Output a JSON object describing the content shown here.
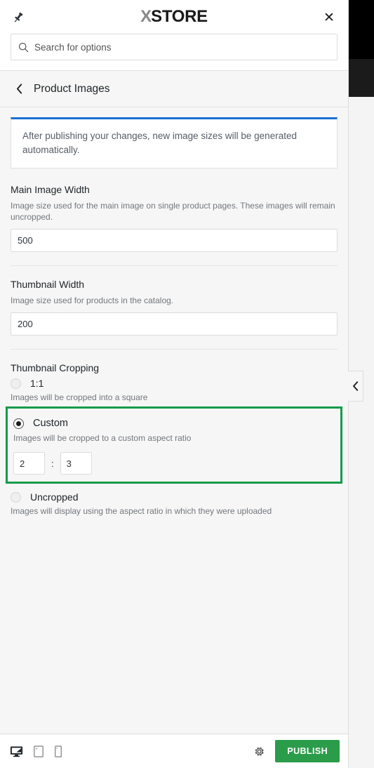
{
  "panel": {
    "header": {
      "pin_icon": "pushpin-icon",
      "logo_x": "X",
      "logo_text": "STORE",
      "close_icon": "✕"
    },
    "search": {
      "icon": "search-icon",
      "placeholder": "Search for options",
      "value": ""
    },
    "section": {
      "back_icon": "chevron-left-icon",
      "title": "Product Images"
    }
  },
  "notice": {
    "text": "After publishing your changes, new image sizes will be generated automatically.",
    "accent_color": "#1a6fd4"
  },
  "fields": {
    "main_image_width": {
      "label": "Main Image Width",
      "description": "Image size used for the main image on single product pages. These images will remain uncropped.",
      "value": "500"
    },
    "thumbnail_width": {
      "label": "Thumbnail Width",
      "description": "Image size used for products in the catalog.",
      "value": "200"
    }
  },
  "thumbnail_cropping": {
    "label": "Thumbnail Cropping",
    "selected": "custom",
    "highlight_color": "#159b4a",
    "options": [
      {
        "id": "1-1",
        "label": "1:1",
        "description": "Images will be cropped into a square",
        "checked": false
      },
      {
        "id": "custom",
        "label": "Custom",
        "description": "Images will be cropped to a custom aspect ratio",
        "checked": true,
        "ratio": {
          "width": "2",
          "separator": ":",
          "height": "3"
        }
      },
      {
        "id": "uncropped",
        "label": "Uncropped",
        "description": "Images will display using the aspect ratio in which they were uploaded",
        "checked": false
      }
    ]
  },
  "footer": {
    "devices": [
      {
        "id": "desktop",
        "icon": "desktop-icon",
        "active": true
      },
      {
        "id": "tablet",
        "icon": "tablet-icon",
        "active": false
      },
      {
        "id": "mobile",
        "icon": "mobile-icon",
        "active": false
      }
    ],
    "settings_icon": "gear-icon",
    "publish_label": "PUBLISH",
    "publish_color": "#2b9c4a"
  },
  "collapse_handle": {
    "icon": "chevron-left-icon"
  }
}
